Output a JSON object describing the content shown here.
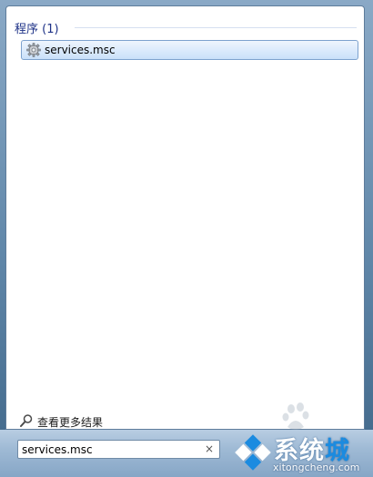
{
  "results": {
    "section_title": "程序 (1)",
    "items": [
      {
        "label": "services.msc",
        "icon": "gear-icon"
      }
    ]
  },
  "more_results": {
    "label": "查看更多结果",
    "icon": "search-icon"
  },
  "search": {
    "value": "services.msc",
    "clear_glyph": "×"
  },
  "watermark": {
    "big_prefix": "系统",
    "big_suffix": "城",
    "small": "xitongcheng.com"
  },
  "colors": {
    "section_title": "#1e3287",
    "highlight_border": "#7da2ce",
    "accent_blue": "#1b8be0"
  }
}
